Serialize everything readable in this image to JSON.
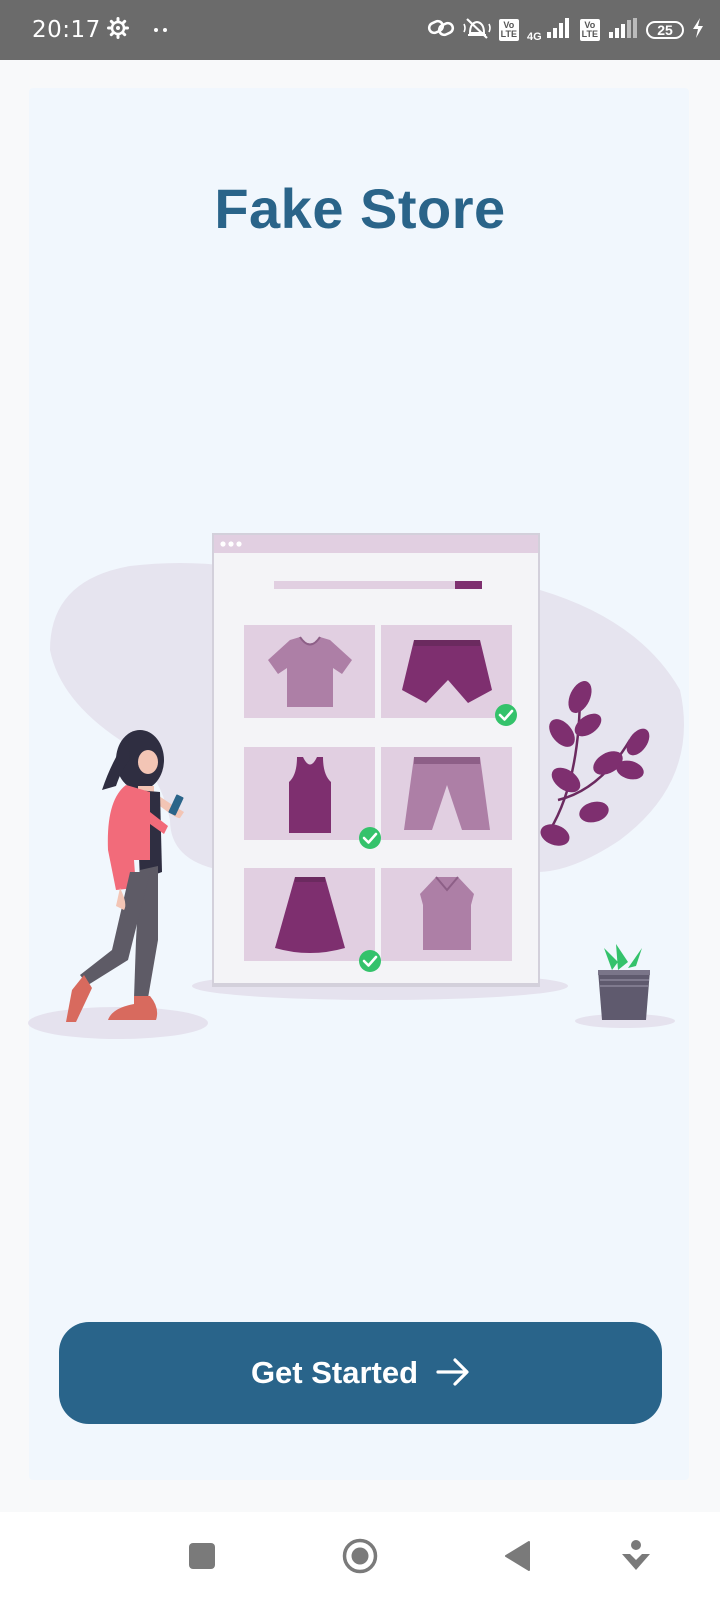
{
  "status_bar": {
    "time": "20:17",
    "network_label": "4G",
    "volte_badge_top": "Vo",
    "volte_badge_bottom": "LTE",
    "battery_level": "25",
    "icons": [
      "settings-gear-icon",
      "more-dots-icon",
      "link-icon",
      "vibrate-off-icon",
      "volte-icon",
      "signal-icon",
      "volte-icon",
      "signal-icon",
      "battery-icon",
      "charging-bolt-icon"
    ]
  },
  "app": {
    "title": "Fake Store"
  },
  "illustration": {
    "icons": [
      "woman-with-phone",
      "browser-window",
      "t-shirt",
      "shorts",
      "tank-top",
      "bermuda-shorts",
      "skirt",
      "sleeveless-shirt",
      "check-mark-icon",
      "plant-branch",
      "potted-plant"
    ],
    "selected_items_count": 3
  },
  "cta": {
    "label": "Get Started",
    "icon": "arrow-right-icon"
  },
  "nav_bar": {
    "icons": [
      "recents-square-icon",
      "home-circle-icon",
      "back-triangle-icon",
      "assistant-icon"
    ]
  },
  "colors": {
    "status_bar_bg": "#6b6b6b",
    "card_bg": "#f1f7fd",
    "title": "#2a6489",
    "button_bg": "#29648a",
    "button_text": "#ffffff",
    "clothing_dark": "#7e2f6f",
    "clothing_light": "#ad7fa6",
    "tile_bg": "#e1cfe1",
    "check_green": "#34c26b",
    "blob": "#e6e4ef"
  }
}
